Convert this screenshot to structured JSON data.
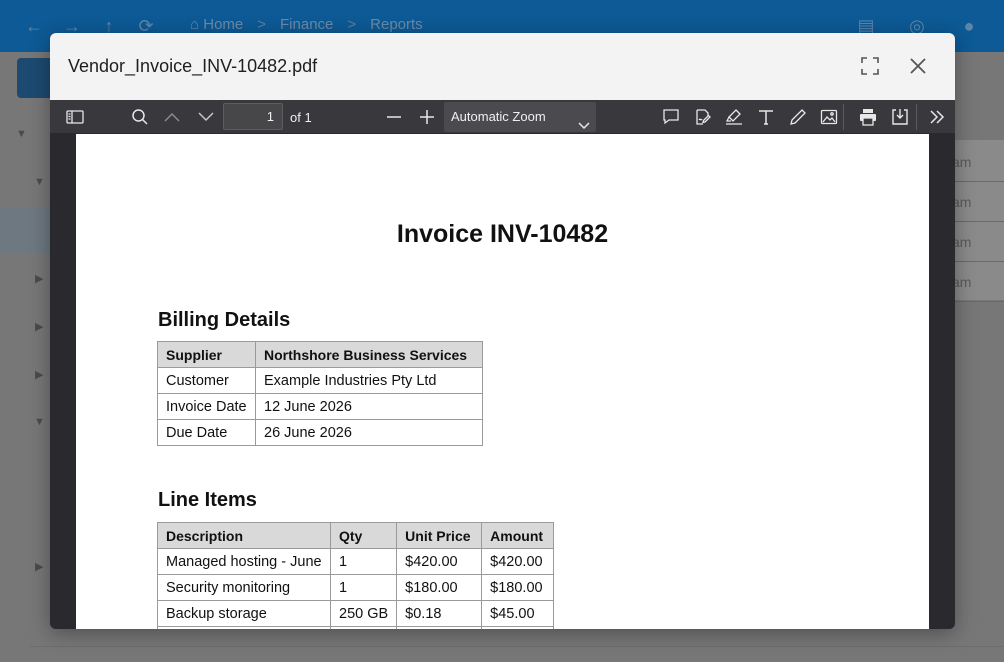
{
  "background": {
    "breadcrumb": [
      "Home",
      "Finance",
      "Reports"
    ],
    "side_rows": [
      "am",
      "am",
      "am",
      "am"
    ]
  },
  "modal": {
    "title": "Vendor_Invoice_INV-10482.pdf",
    "toolbar": {
      "page_number": "1",
      "page_of": "of 1",
      "zoom": "Automatic Zoom"
    },
    "document": {
      "title": "Invoice INV-10482",
      "billing_heading": "Billing Details",
      "billing_table": {
        "header": [
          "Supplier",
          "Northshore Business Services"
        ],
        "rows": [
          [
            "Customer",
            "Example Industries Pty Ltd"
          ],
          [
            "Invoice Date",
            "12 June 2026"
          ],
          [
            "Due Date",
            "26 June 2026"
          ]
        ]
      },
      "line_items_heading": "Line Items",
      "line_items_table": {
        "header": [
          "Description",
          "Qty",
          "Unit Price",
          "Amount"
        ],
        "rows": [
          [
            "Managed hosting - June",
            "1",
            "$420.00",
            "$420.00"
          ],
          [
            "Security monitoring",
            "1",
            "$180.00",
            "$180.00"
          ],
          [
            "Backup storage",
            "250 GB",
            "$0.18",
            "$45.00"
          ]
        ]
      }
    }
  },
  "colors": {
    "app_bar": "#0d5a96",
    "modal_header": "#f3f3f3",
    "toolbar": "#38383d",
    "table_header": "#d9d9d9"
  }
}
